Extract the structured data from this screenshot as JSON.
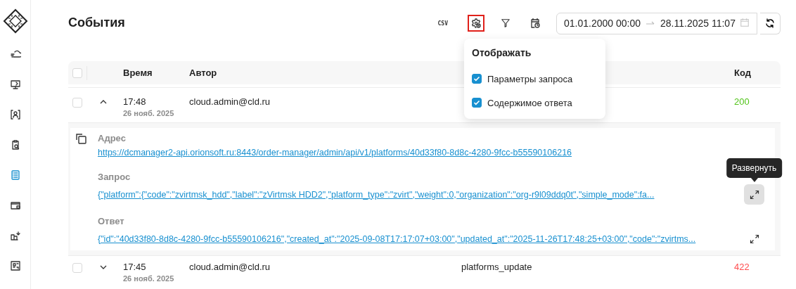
{
  "sidebar": {
    "items": [
      {
        "selected": false
      },
      {
        "selected": false
      },
      {
        "selected": false
      },
      {
        "selected": false
      },
      {
        "selected": true
      },
      {
        "selected": false
      },
      {
        "selected": false
      },
      {
        "selected": false
      }
    ]
  },
  "page": {
    "title": "События"
  },
  "toolbar": {
    "csv_button": "CSV",
    "display_button": {
      "highlighted": true,
      "open": true
    },
    "date_range": {
      "start": "01.01.2000 00:00",
      "end": "28.11.2025 11:07"
    }
  },
  "display_menu": {
    "title": "Отображать",
    "options": [
      {
        "label": "Параметры запроса",
        "checked": true
      },
      {
        "label": "Содержимое ответа",
        "checked": true
      }
    ]
  },
  "table": {
    "all_checked": false,
    "columns": [
      "Время",
      "Автор",
      "Код"
    ],
    "rows": [
      {
        "checked": false,
        "expanded": true,
        "time": "17:48",
        "date": "26 нояб. 2025",
        "author": "cloud.admin@cld.ru",
        "code": "200",
        "color": "#52c41a",
        "details": [
          {
            "label": "Адрес",
            "value": "https://dcmanager2-api.orionsoft.ru:8443/order-manager/admin/api/v1/platforms/40d33f80-8d8c-4280-9fcc-b55590106216",
            "expandable": false
          },
          {
            "label": "Запрос",
            "value": "{\"platform\":{\"code\":\"zvirtmsk_hdd\",\"label\":\"zVirtmsk HDD2\",\"platform_type\":\"zvirt\",\"weight\":0,\"organization\":\"org-r9l09ddq0t\",\"simple_mode\":fa...",
            "expandable": true,
            "hovered": true,
            "tooltip": "Развернуть"
          },
          {
            "label": "Ответ",
            "value": "{\"id\":\"40d33f80-8d8c-4280-9fcc-b55590106216\",\"created_at\":\"2025-09-08T17:17:07+03:00\",\"updated_at\":\"2025-11-26T17:48:25+03:00\",\"code\":\"zvirtms...",
            "expandable": true,
            "hovered": false
          }
        ]
      },
      {
        "checked": false,
        "expanded": false,
        "time": "17:45",
        "date": "26 нояб. 2025",
        "author": "cloud.admin@cld.ru",
        "column_3": "platforms_update",
        "code": "422",
        "color": "#ff4d4f"
      }
    ]
  }
}
